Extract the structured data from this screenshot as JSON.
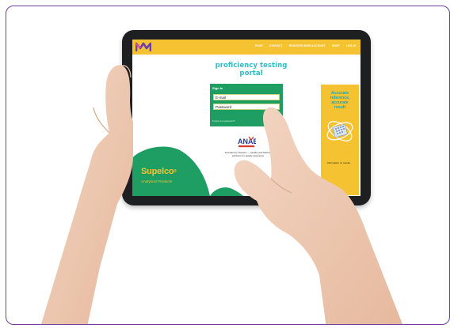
{
  "nav": {
    "links": [
      "PAGE",
      "CONTACT",
      "REGISTER NEW ACCOUNT",
      "SHOP",
      "LOG IN"
    ]
  },
  "hero": {
    "title_line1": "proficiency testing",
    "title_line2": "portal"
  },
  "signin": {
    "heading": "Sign In",
    "email_placeholder": "E-mail",
    "password_placeholder": "Password",
    "forgot_link": "Forgot your password?",
    "login_button": "LOG IN"
  },
  "accreditation": {
    "badge": "ANAB"
  },
  "provided": {
    "line1": "Provided by Supelco — Quality and Method",
    "line2": "solutions for quality assurance"
  },
  "promo": {
    "line1": "Accurate",
    "line2": "reference,",
    "line3": "accurate",
    "line4": "result",
    "note": "Information on results."
  },
  "brand": {
    "name": "Supelco",
    "mark": "®",
    "subtitle": "Analytical Products"
  },
  "colors": {
    "frame": "#6d3ea0",
    "accent_yellow": "#f5c232",
    "accent_green": "#1f9e64",
    "title_teal": "#2dbfc5",
    "tablet_bezel": "#1d1f21"
  }
}
